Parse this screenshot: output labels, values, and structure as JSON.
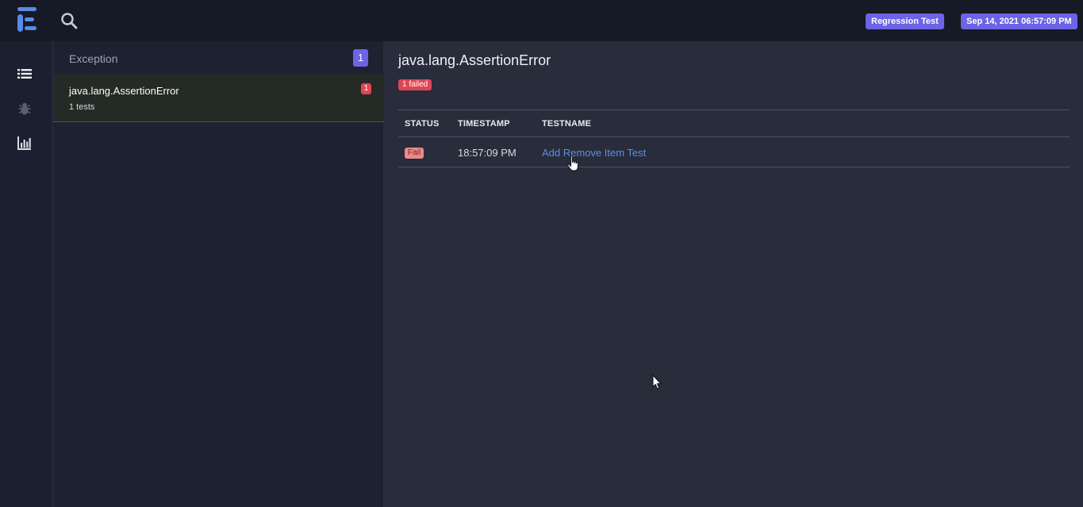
{
  "topbar": {
    "suite_badge": "Regression Test",
    "date_badge": "Sep 14, 2021 06:57:09 PM"
  },
  "sidenav": {
    "items": [
      "list-icon",
      "bug-icon",
      "chart-icon"
    ]
  },
  "exception_panel": {
    "title": "Exception",
    "count": "1",
    "items": [
      {
        "name": "java.lang.AssertionError",
        "sub": "1 tests",
        "count": "1"
      }
    ]
  },
  "detail": {
    "title": "java.lang.AssertionError",
    "failed_badge": "1 failed",
    "columns": [
      "STATUS",
      "TIMESTAMP",
      "TESTNAME"
    ],
    "rows": [
      {
        "status": "Fail",
        "timestamp": "18:57:09 PM",
        "testname": "Add Remove Item Test"
      }
    ]
  },
  "colors": {
    "accent": "#6c63e6",
    "fail": "#e04556",
    "link": "#5b8fe0",
    "topbar_bg": "#151a26"
  }
}
